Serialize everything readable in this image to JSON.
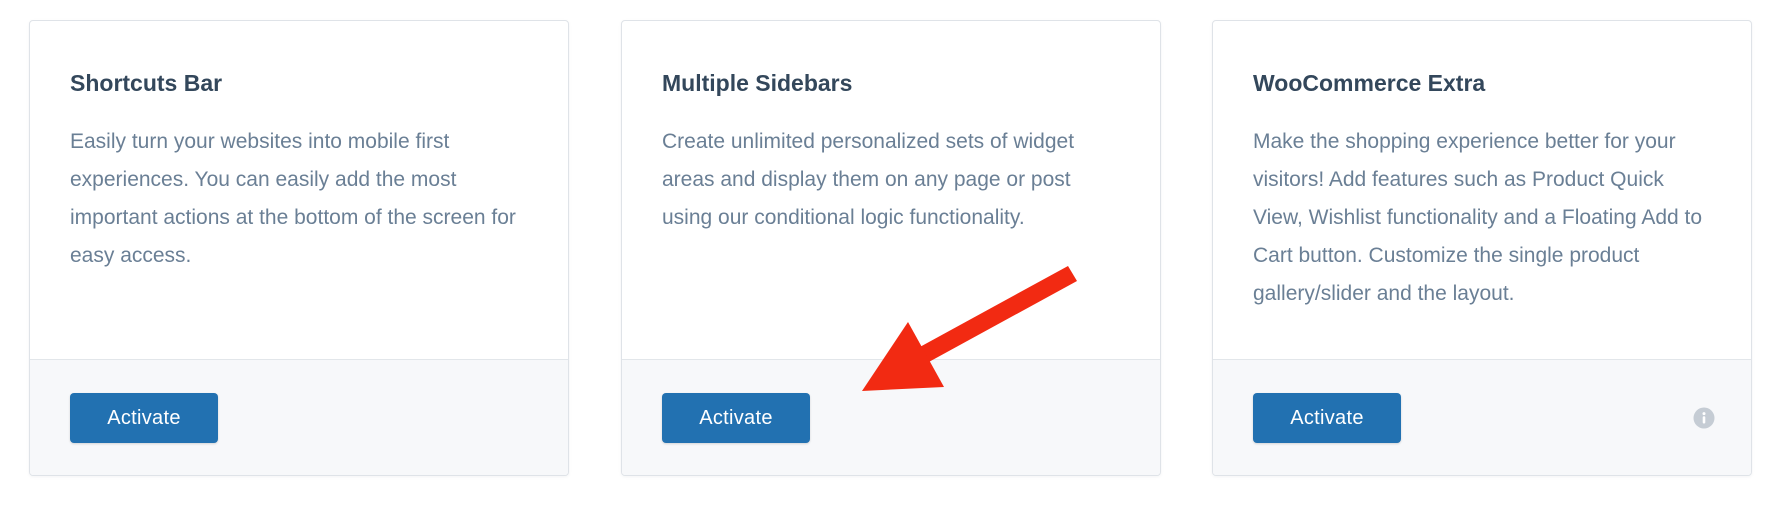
{
  "cards": [
    {
      "title": "Shortcuts Bar",
      "description": "Easily turn your websites into mobile first experiences. You can easily add the most important actions at the bottom of the screen for easy access.",
      "button_label": "Activate",
      "has_info_icon": false
    },
    {
      "title": "Multiple Sidebars",
      "description": "Create unlimited personalized sets of widget areas and display them on any page or post using our conditional logic functionality.",
      "button_label": "Activate",
      "has_info_icon": false
    },
    {
      "title": "WooCommerce Extra",
      "description": "Make the shopping experience better for your visitors! Add features such as Product Quick View, Wishlist functionality and a Floating Add to Cart button. Customize the single product gallery/slider and the layout.",
      "button_label": "Activate",
      "has_info_icon": true
    }
  ],
  "icons": {
    "info": "info-icon",
    "annotation": "red-arrow-annotation"
  },
  "colors": {
    "button": "#2271b1",
    "title": "#33475b",
    "description": "#6a7f95",
    "footer_bg": "#f7f8fa",
    "arrow": "#f22a12"
  }
}
